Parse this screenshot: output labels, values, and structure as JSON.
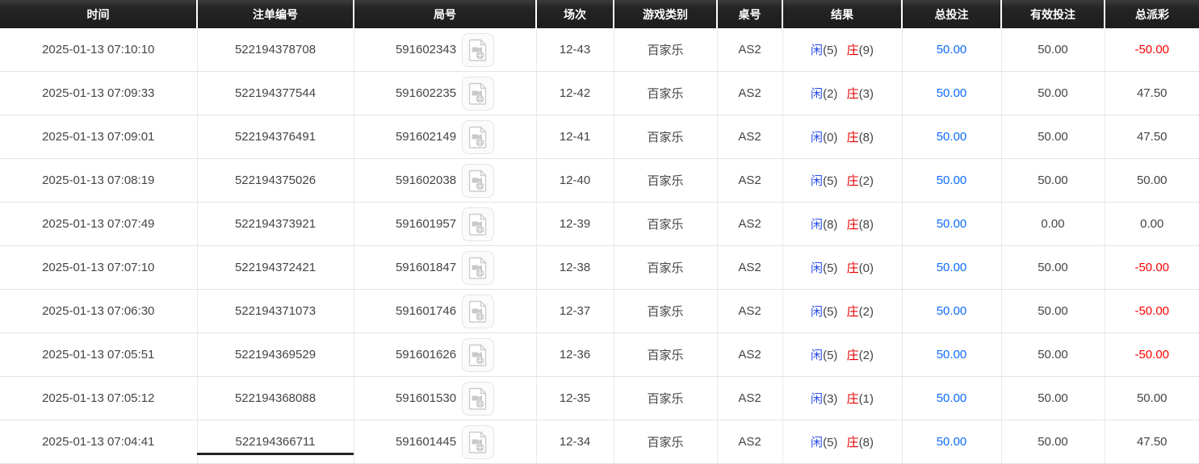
{
  "theme": {
    "player_blue": "#2b50e8",
    "banker_red": "#e60000",
    "link_blue": "#0d6bff",
    "payout_red": "#ff0000",
    "text_color": "#444444",
    "header_bg": "#1d1d1d"
  },
  "table": {
    "columns": {
      "time": "时间",
      "bet_id": "注单编号",
      "round_id": "局号",
      "session": "场次",
      "game_type": "游戏类别",
      "table_no": "桌号",
      "result": "结果",
      "total_bet": "总投注",
      "valid_bet": "有效投注",
      "total_payout": "总派彩"
    },
    "result_labels": {
      "player": "闲",
      "banker": "庄"
    },
    "rows": [
      {
        "time": "2025-01-13 07:10:10",
        "bet_id": "522194378708",
        "round_id": "591602343",
        "session": "12-43",
        "game_type": "百家乐",
        "table_no": "AS2",
        "player_score": "5",
        "banker_score": "9",
        "total_bet": "50.00",
        "valid_bet": "50.00",
        "total_payout": "-50.00"
      },
      {
        "time": "2025-01-13 07:09:33",
        "bet_id": "522194377544",
        "round_id": "591602235",
        "session": "12-42",
        "game_type": "百家乐",
        "table_no": "AS2",
        "player_score": "2",
        "banker_score": "3",
        "total_bet": "50.00",
        "valid_bet": "50.00",
        "total_payout": "47.50"
      },
      {
        "time": "2025-01-13 07:09:01",
        "bet_id": "522194376491",
        "round_id": "591602149",
        "session": "12-41",
        "game_type": "百家乐",
        "table_no": "AS2",
        "player_score": "0",
        "banker_score": "8",
        "total_bet": "50.00",
        "valid_bet": "50.00",
        "total_payout": "47.50"
      },
      {
        "time": "2025-01-13 07:08:19",
        "bet_id": "522194375026",
        "round_id": "591602038",
        "session": "12-40",
        "game_type": "百家乐",
        "table_no": "AS2",
        "player_score": "5",
        "banker_score": "2",
        "total_bet": "50.00",
        "valid_bet": "50.00",
        "total_payout": "50.00"
      },
      {
        "time": "2025-01-13 07:07:49",
        "bet_id": "522194373921",
        "round_id": "591601957",
        "session": "12-39",
        "game_type": "百家乐",
        "table_no": "AS2",
        "player_score": "8",
        "banker_score": "8",
        "total_bet": "50.00",
        "valid_bet": "0.00",
        "total_payout": "0.00"
      },
      {
        "time": "2025-01-13 07:07:10",
        "bet_id": "522194372421",
        "round_id": "591601847",
        "session": "12-38",
        "game_type": "百家乐",
        "table_no": "AS2",
        "player_score": "5",
        "banker_score": "0",
        "total_bet": "50.00",
        "valid_bet": "50.00",
        "total_payout": "-50.00"
      },
      {
        "time": "2025-01-13 07:06:30",
        "bet_id": "522194371073",
        "round_id": "591601746",
        "session": "12-37",
        "game_type": "百家乐",
        "table_no": "AS2",
        "player_score": "5",
        "banker_score": "2",
        "total_bet": "50.00",
        "valid_bet": "50.00",
        "total_payout": "-50.00"
      },
      {
        "time": "2025-01-13 07:05:51",
        "bet_id": "522194369529",
        "round_id": "591601626",
        "session": "12-36",
        "game_type": "百家乐",
        "table_no": "AS2",
        "player_score": "5",
        "banker_score": "2",
        "total_bet": "50.00",
        "valid_bet": "50.00",
        "total_payout": "-50.00"
      },
      {
        "time": "2025-01-13 07:05:12",
        "bet_id": "522194368088",
        "round_id": "591601530",
        "session": "12-35",
        "game_type": "百家乐",
        "table_no": "AS2",
        "player_score": "3",
        "banker_score": "1",
        "total_bet": "50.00",
        "valid_bet": "50.00",
        "total_payout": "50.00"
      },
      {
        "time": "2025-01-13 07:04:41",
        "bet_id": "522194366711",
        "round_id": "591601445",
        "session": "12-34",
        "game_type": "百家乐",
        "table_no": "AS2",
        "player_score": "5",
        "banker_score": "8",
        "total_bet": "50.00",
        "valid_bet": "50.00",
        "total_payout": "47.50"
      }
    ],
    "icons": {
      "video_replay": "video-file-icon"
    }
  }
}
